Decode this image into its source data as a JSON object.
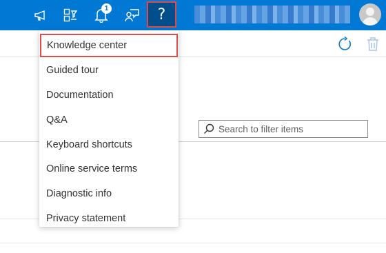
{
  "topbar": {
    "icons": [
      "megaphone-icon",
      "directory-filter-icon",
      "bell-icon",
      "feedback-icon",
      "question-icon"
    ],
    "notifications_count": "1",
    "help_label": "?",
    "accent": "#0078d4",
    "help_active_bg": "#004e8c"
  },
  "toolbar": {
    "icons": [
      "refresh-icon",
      "delete-icon"
    ]
  },
  "search": {
    "placeholder": "Search to filter items",
    "value": ""
  },
  "help_menu": {
    "items": [
      {
        "label": "Knowledge center"
      },
      {
        "label": "Guided tour"
      },
      {
        "label": "Documentation"
      },
      {
        "label": "Q&A"
      },
      {
        "label": "Keyboard shortcuts"
      },
      {
        "label": "Online service terms"
      },
      {
        "label": "Diagnostic info"
      },
      {
        "label": "Privacy statement"
      }
    ]
  },
  "highlight_color": "#e04a4a"
}
